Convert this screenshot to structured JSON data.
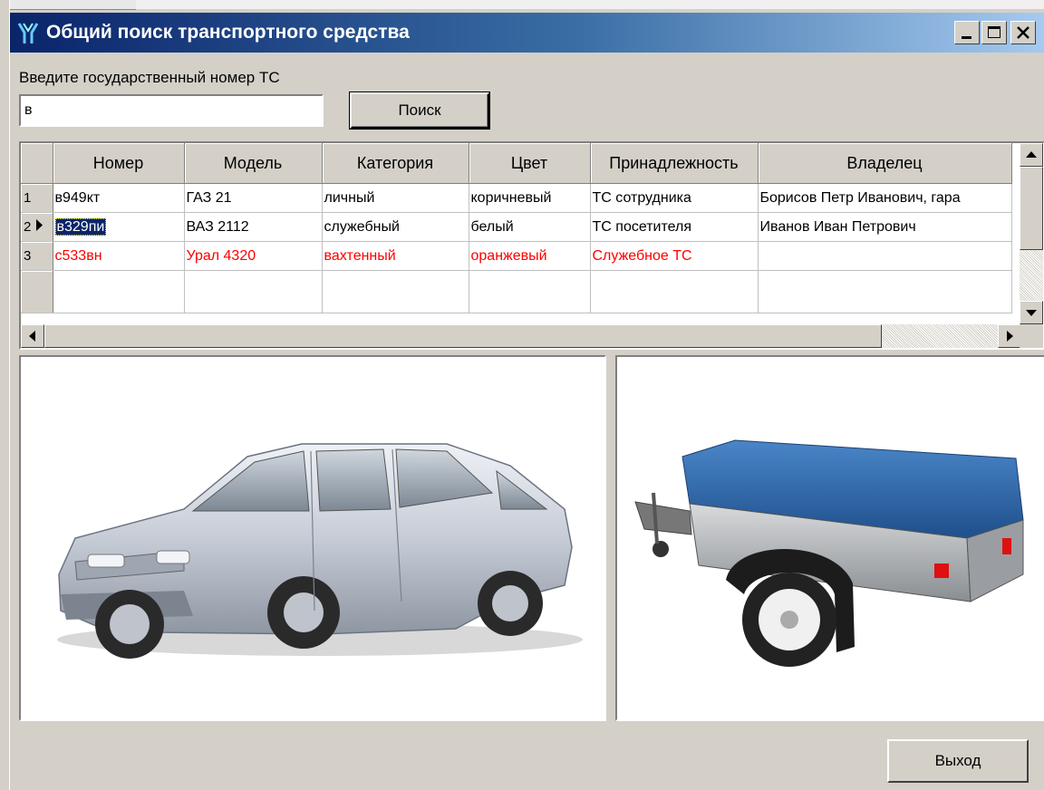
{
  "window": {
    "title": "Общий поиск транспортного средства"
  },
  "search": {
    "label": "Введите государственный номер ТС",
    "value": "в",
    "button_label": "Поиск"
  },
  "table": {
    "columns": [
      "Номер",
      "Модель",
      "Категория",
      "Цвет",
      "Принадлежность",
      "Владелец"
    ],
    "rows": [
      {
        "num": "1",
        "cells": [
          "в949кт",
          "ГАЗ 21",
          "личный",
          "коричневый",
          "ТС сотрудника",
          "Борисов Петр Иванович, гара"
        ]
      },
      {
        "num": "2",
        "cells": [
          "в329пи",
          "ВАЗ 2112",
          "служебный",
          "белый",
          "ТС посетителя",
          "Иванов Иван Петрович"
        ]
      },
      {
        "num": "3",
        "cells": [
          "с533вн",
          "Урал 4320",
          "вахтенный",
          "оранжевый",
          "Служебное ТС",
          ""
        ]
      }
    ],
    "selected_row": 2,
    "highlight_row": 3
  },
  "colors": {
    "titlebar_start": "#0a246a",
    "titlebar_end": "#a6caf0",
    "highlight_text": "#ff0000",
    "selection": "#0a246a"
  },
  "photos": {
    "left": "car-photo",
    "right": "trailer-photo"
  },
  "footer": {
    "exit_label": "Выход"
  }
}
